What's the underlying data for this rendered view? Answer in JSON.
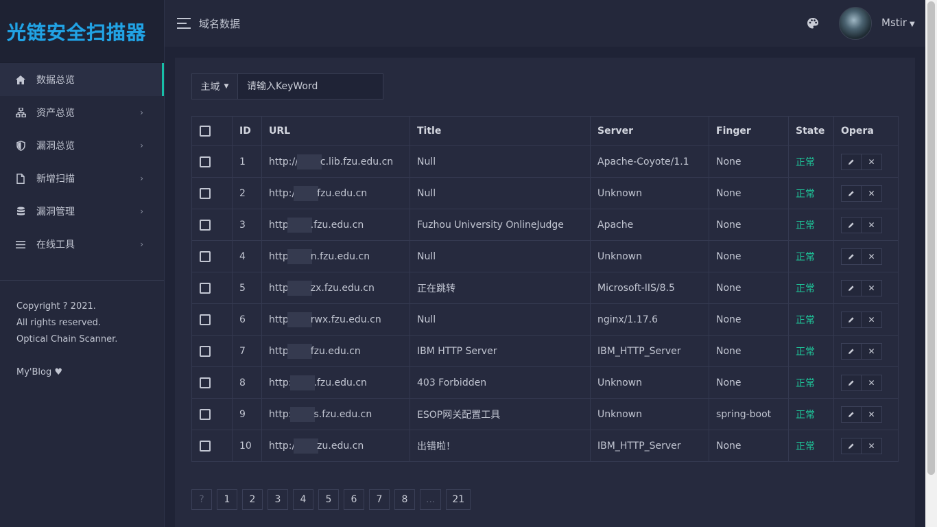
{
  "app": {
    "logo_text": "光链安全扫描器"
  },
  "header": {
    "title": "域名数据",
    "user": "Mstir"
  },
  "sidebar": {
    "items": [
      {
        "label": "数据总览",
        "icon": "home-icon",
        "active": true
      },
      {
        "label": "资产总览",
        "icon": "sitemap-icon"
      },
      {
        "label": "漏洞总览",
        "icon": "shield-icon"
      },
      {
        "label": "新增扫描",
        "icon": "file-icon"
      },
      {
        "label": "漏洞管理",
        "icon": "database-icon"
      },
      {
        "label": "在线工具",
        "icon": "menu-icon"
      }
    ],
    "footer": [
      "Copyright ? 2021.",
      "All rights reserved.",
      "Optical Chain Scanner."
    ],
    "blog": "My'Blog ♥"
  },
  "search": {
    "scope": "主域",
    "placeholder": "请输入KeyWord"
  },
  "table": {
    "headers": [
      "ID",
      "URL",
      "Title",
      "Server",
      "Finger",
      "State",
      "Opera"
    ],
    "rows": [
      {
        "id": "1",
        "url_a": "http://",
        "url_b": "c.lib.fzu.edu.cn",
        "title": "Null",
        "server": "Apache-Coyote/1.1",
        "finger": "None",
        "state": "正常"
      },
      {
        "id": "2",
        "url_a": "http:/",
        "url_b": "fzu.edu.cn",
        "title": "Null",
        "server": "Unknown",
        "finger": "None",
        "state": "正常"
      },
      {
        "id": "3",
        "url_a": "http",
        "url_b": ".fzu.edu.cn",
        "title": "Fuzhou University OnlineJudge",
        "server": "Apache",
        "finger": "None",
        "state": "正常"
      },
      {
        "id": "4",
        "url_a": "http",
        "url_b": "n.fzu.edu.cn",
        "title": "Null",
        "server": "Unknown",
        "finger": "None",
        "state": "正常"
      },
      {
        "id": "5",
        "url_a": "http",
        "url_b": "zx.fzu.edu.cn",
        "title": "正在跳转",
        "server": "Microsoft-IIS/8.5",
        "finger": "None",
        "state": "正常"
      },
      {
        "id": "6",
        "url_a": "http",
        "url_b": "rwx.fzu.edu.cn",
        "title": "Null",
        "server": "nginx/1.17.6",
        "finger": "None",
        "state": "正常"
      },
      {
        "id": "7",
        "url_a": "http",
        "url_b": "fzu.edu.cn",
        "title": "IBM HTTP Server",
        "server": "IBM_HTTP_Server",
        "finger": "None",
        "state": "正常"
      },
      {
        "id": "8",
        "url_a": "http:",
        "url_b": ".fzu.edu.cn",
        "title": "403 Forbidden",
        "server": "Unknown",
        "finger": "None",
        "state": "正常"
      },
      {
        "id": "9",
        "url_a": "http:",
        "url_b": "s.fzu.edu.cn",
        "title": "ESOP网关配置工具",
        "server": "Unknown",
        "finger": "spring-boot",
        "state": "正常"
      },
      {
        "id": "10",
        "url_a": "http:/",
        "url_b": "zu.edu.cn",
        "title": "出错啦！",
        "server": "IBM_HTTP_Server",
        "finger": "None",
        "state": "正常"
      }
    ]
  },
  "pagination": {
    "prev": "?",
    "pages": [
      "1",
      "2",
      "3",
      "4",
      "5",
      "6",
      "7",
      "8"
    ],
    "ellipsis": "...",
    "last": "21"
  },
  "colors": {
    "accent": "#18bfa8",
    "state_ok": "#1ec89b",
    "logo": "#22a3e4",
    "bg": "#1f2336"
  }
}
